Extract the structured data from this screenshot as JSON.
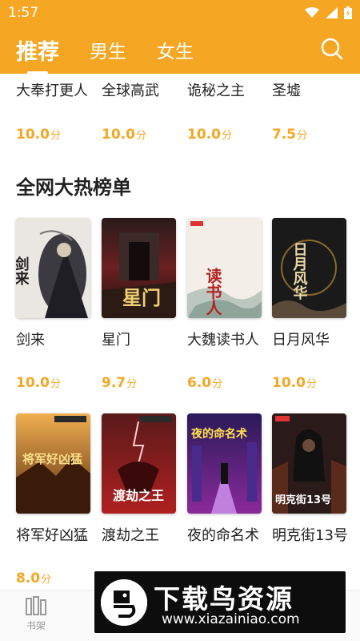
{
  "status": {
    "time": "1:57"
  },
  "nav": {
    "tabs": [
      {
        "label": "推荐",
        "active": true
      },
      {
        "label": "男生"
      },
      {
        "label": "女生"
      }
    ]
  },
  "top_row": [
    {
      "title": "大奉打更人",
      "score": "10.0",
      "unit": "分"
    },
    {
      "title": "全球高武",
      "score": "10.0",
      "unit": "分"
    },
    {
      "title": "诡秘之主",
      "score": "10.0",
      "unit": "分"
    },
    {
      "title": "圣墟",
      "score": "7.5",
      "unit": "分"
    }
  ],
  "hot_section": {
    "title": "全网大热榜单",
    "row1": [
      {
        "title": "剑来",
        "score": "10.0",
        "unit": "分",
        "cover_text": "剑来"
      },
      {
        "title": "星门",
        "score": "9.7",
        "unit": "分",
        "cover_text": "星门"
      },
      {
        "title": "大魏读书人",
        "score": "6.0",
        "unit": "分",
        "cover_text": "读书人"
      },
      {
        "title": "日月风华",
        "score": "10.0",
        "unit": "分",
        "cover_text": "日月风华"
      }
    ],
    "row2": [
      {
        "title": "将军好凶猛",
        "score": "8.0",
        "unit": "分",
        "cover_text": "将军好凶猛"
      },
      {
        "title": "渡劫之王",
        "cover_text": "渡劫之王"
      },
      {
        "title": "夜的命名术",
        "cover_text": "夜的命名术"
      },
      {
        "title": "明克街13号",
        "cover_text": "明克街13号"
      }
    ]
  },
  "bottom_nav": [
    {
      "label": "书架"
    }
  ],
  "watermark": {
    "title": "下载鸟资源",
    "url": "www.xiazainiao.com"
  },
  "colors": {
    "accent": "#f5a623",
    "text": "#222222"
  }
}
